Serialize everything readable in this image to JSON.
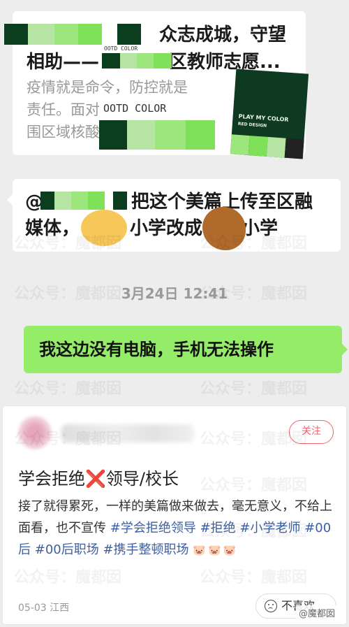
{
  "chat": {
    "message1": {
      "title_part": "众志成城，守望",
      "title_line2_prefix": "相助——",
      "title_line2_suffix": "区教师志愿...",
      "desc_line1": "疫情就是命令，防控就是",
      "desc_line2": "责任。面对",
      "desc_line3": "围区域核酸"
    },
    "stickers": {
      "ootd_small": "OOTD COLOR",
      "ootd_large": "OOTD COLOR",
      "card_line1": "PLAY MY COLOR",
      "card_line2": "RED DESIGN"
    },
    "message2": {
      "prefix": "@",
      "line1_suffix": "把这个美篇上传至区融",
      "line2_a": "媒体，",
      "line2_b": "小学改成",
      "line2_c": "小学"
    },
    "timestamp": "3月24日 12:41",
    "message3": "我这边没有电脑，手机无法操作"
  },
  "watermark": "公众号：魔都囡",
  "post": {
    "follow_label": "关注",
    "title_a": "学会拒绝",
    "title_x": "❌",
    "title_b": "领导/校长",
    "body_text": "接了就得累死，一样的美篇做来做去，毫无意义，不给上面看，也不宣传",
    "tags": [
      "#学会拒绝领导",
      "#拒绝",
      "#小学老师",
      "#00后",
      "#00后职场",
      "#携手整顿职场"
    ],
    "emoji": "🐷🐷🐷",
    "meta": "05-03 江西",
    "dislike_label": "不喜欢",
    "source_tag": "@魔都囡"
  },
  "colors": {
    "wechat_green": "#95ec69",
    "sticker_dark": "#0b3d1f",
    "sticker_light": "#7fe05a",
    "follow_red": "#f06370",
    "tag_blue": "#3b5fa0"
  }
}
